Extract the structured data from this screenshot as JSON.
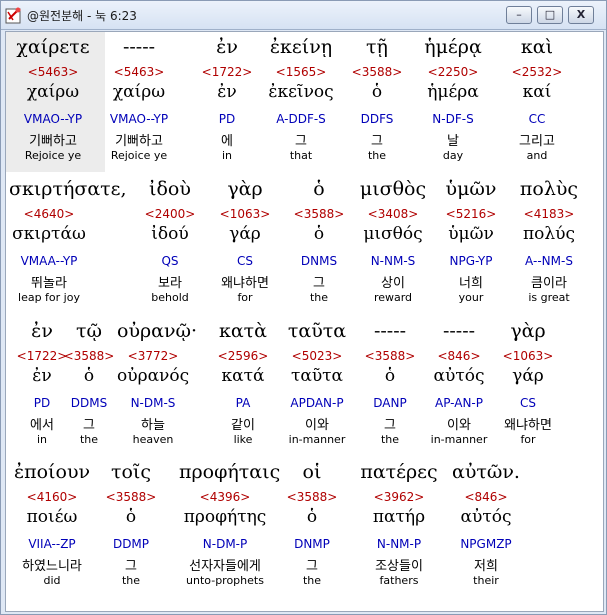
{
  "window": {
    "title": "@원전분해 - 눅 6:23",
    "buttons": {
      "minimize": "–",
      "maximize": "□",
      "close": "X"
    }
  },
  "verse": {
    "rows": [
      {
        "words": [
          {
            "greek": "χαίρετε",
            "strong": "<5463>",
            "lemma": "χαίρω",
            "parse": "VMAO--YP",
            "korean": "기뻐하고",
            "english": "Rejoice ye"
          },
          {
            "greek": "-----",
            "strong": "<5463>",
            "lemma": "χαίρω",
            "parse": "VMAO--YP",
            "korean": "기뻐하고",
            "english": "Rejoice ye"
          },
          {
            "greek": "ἐν",
            "strong": "<1722>",
            "lemma": "ἐν",
            "parse": "PD",
            "korean": "에",
            "english": "in"
          },
          {
            "greek": "ἐκείνῃ",
            "strong": "<1565>",
            "lemma": "ἐκεῖνος",
            "parse": "A-DDF-S",
            "korean": "그",
            "english": "that"
          },
          {
            "greek": "τῇ",
            "strong": "<3588>",
            "lemma": "ὁ",
            "parse": "DDFS",
            "korean": "그",
            "english": "the"
          },
          {
            "greek": "ἡμέρᾳ",
            "strong": "<2250>",
            "lemma": "ἡμέρα",
            "parse": "N-DF-S",
            "korean": "날",
            "english": "day"
          },
          {
            "greek": "καὶ",
            "strong": "<2532>",
            "lemma": "καί",
            "parse": "CC",
            "korean": "그리고",
            "english": "and"
          }
        ]
      },
      {
        "words": [
          {
            "greek": "σκιρτήσατε,",
            "strong": "<4640>",
            "lemma": "σκιρτάω",
            "parse": "VMAA--YP",
            "korean": "뛰놀라",
            "english": "leap for joy"
          },
          {
            "greek": "ἰδοὺ",
            "strong": "<2400>",
            "lemma": "ἰδού",
            "parse": "QS",
            "korean": "보라",
            "english": "behold"
          },
          {
            "greek": "γὰρ",
            "strong": "<1063>",
            "lemma": "γάρ",
            "parse": "CS",
            "korean": "왜냐하면",
            "english": "for"
          },
          {
            "greek": "ὁ",
            "strong": "<3588>",
            "lemma": "ὁ",
            "parse": "DNMS",
            "korean": "그",
            "english": "the"
          },
          {
            "greek": "μισθὸς",
            "strong": "<3408>",
            "lemma": "μισθός",
            "parse": "N-NM-S",
            "korean": "상이",
            "english": "reward"
          },
          {
            "greek": "ὑμῶν",
            "strong": "<5216>",
            "lemma": "ὑμῶν",
            "parse": "NPG-YP",
            "korean": "너희",
            "english": "your"
          },
          {
            "greek": "πολὺς",
            "strong": "<4183>",
            "lemma": "πολύς",
            "parse": "A--NM-S",
            "korean": "큼이라",
            "english": "is great"
          }
        ]
      },
      {
        "words": [
          {
            "greek": "ἐν",
            "strong": "<1722>",
            "lemma": "ἐν",
            "parse": "PD",
            "korean": "에서",
            "english": "in"
          },
          {
            "greek": "τῷ",
            "strong": "<3588>",
            "lemma": "ὁ",
            "parse": "DDMS",
            "korean": "그",
            "english": "the"
          },
          {
            "greek": "οὐρανῷ·",
            "strong": "<3772>",
            "lemma": "οὐρανός",
            "parse": "N-DM-S",
            "korean": "하늘",
            "english": "heaven"
          },
          {
            "greek": "κατὰ",
            "strong": "<2596>",
            "lemma": "κατά",
            "parse": "PA",
            "korean": "같이",
            "english": "like"
          },
          {
            "greek": "ταῦτα",
            "strong": "<5023>",
            "lemma": "ταῦτα",
            "parse": "APDAN-P",
            "korean": "이와",
            "english": "in-manner"
          },
          {
            "greek": "-----",
            "strong": "<3588>",
            "lemma": "ὁ",
            "parse": "DANP",
            "korean": "그",
            "english": "the"
          },
          {
            "greek": "-----",
            "strong": "<846>",
            "lemma": "αὐτός",
            "parse": "AP-AN-P",
            "korean": "이와",
            "english": "in-manner"
          },
          {
            "greek": "γὰρ",
            "strong": "<1063>",
            "lemma": "γάρ",
            "parse": "CS",
            "korean": "왜냐하면",
            "english": "for"
          }
        ]
      },
      {
        "words": [
          {
            "greek": "ἐποίουν",
            "strong": "<4160>",
            "lemma": "ποιέω",
            "parse": "VIIA--ZP",
            "korean": "하였느니라",
            "english": "did"
          },
          {
            "greek": "τοῖς",
            "strong": "<3588>",
            "lemma": "ὁ",
            "parse": "DDMP",
            "korean": "그",
            "english": "the"
          },
          {
            "greek": "προφήταις",
            "strong": "<4396>",
            "lemma": "προφήτης",
            "parse": "N-DM-P",
            "korean": "선자자들에게",
            "english": "unto-prophets"
          },
          {
            "greek": "οἱ",
            "strong": "<3588>",
            "lemma": "ὁ",
            "parse": "DNMP",
            "korean": "그",
            "english": "the"
          },
          {
            "greek": "πατέρες",
            "strong": "<3962>",
            "lemma": "πατήρ",
            "parse": "N-NM-P",
            "korean": "조상들이",
            "english": "fathers"
          },
          {
            "greek": "αὐτῶν.",
            "strong": "<846>",
            "lemma": "αὐτός",
            "parse": "NPGMZP",
            "korean": "저희",
            "english": "their"
          }
        ]
      }
    ]
  }
}
